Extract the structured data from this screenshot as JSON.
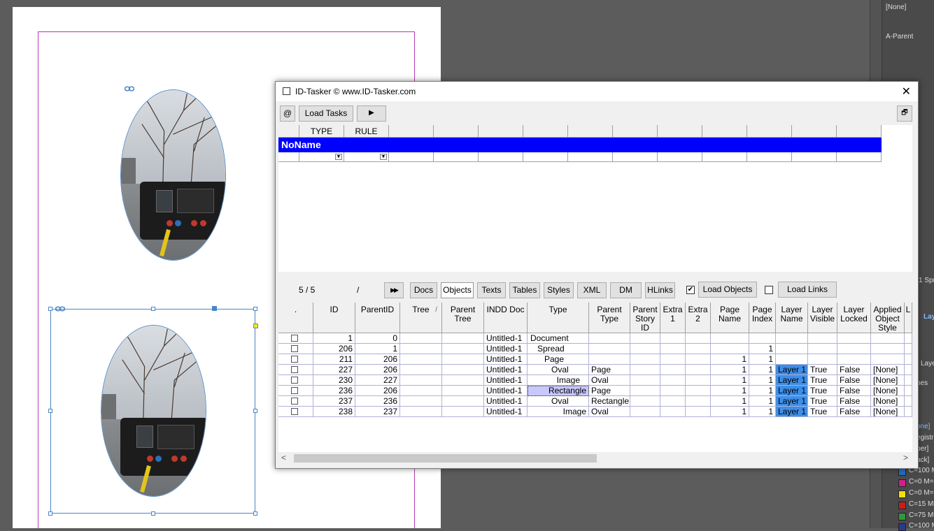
{
  "right_panel": {
    "none_label": "[None]",
    "a_parent_label": "A-Parent",
    "fragments": [
      "1 Spr",
      "Lay",
      "Laye",
      "hes",
      "one]",
      "egistra",
      "per]",
      "ack]",
      "C=100 M=",
      "C=0 M=",
      "C=0 M=",
      "C=15 M=",
      "C=75 M=",
      "C=100 M="
    ],
    "swatch_colors": [
      "#1f6fc2",
      "#d0208a",
      "#f2e000",
      "#c42020",
      "#2e9a3a",
      "#2a3a8c"
    ]
  },
  "dialog": {
    "title": "ID-Tasker  © www.ID-Tasker.com",
    "close_symbol": "✕",
    "at_label": "@",
    "load_tasks_label": "Load Tasks",
    "play_symbol": "▶",
    "restore_symbol": "🗗",
    "task_grid": {
      "headers": [
        "",
        "TYPE",
        "RULE",
        "",
        "",
        "",
        "",
        "",
        "",
        "",
        "",
        "",
        ""
      ],
      "noname": "NoName"
    },
    "toolbar2": {
      "counter": "5 / 5",
      "slash": "/",
      "ff_symbol": "▶▶",
      "tabs": [
        "Docs",
        "Objects",
        "Texts",
        "Tables",
        "Styles",
        "XML",
        "DM",
        "HLinks"
      ],
      "active_tab": "Objects",
      "load_objects_checked": true,
      "load_objects_label": "Load Objects",
      "load_links_checked": false,
      "load_links_label": "Load Links"
    },
    "objects_grid": {
      "headers": [
        ".",
        "ID",
        "ParentID",
        "Tree",
        "Parent Tree",
        "INDD Doc",
        "Type",
        "Parent Type",
        "Parent Story ID",
        "Extra 1",
        "Extra 2",
        "Page Name",
        "Page Index",
        "Layer Name",
        "Layer Visible",
        "Layer Locked",
        "Applied Object Style",
        "L"
      ],
      "sort_indicator": "/",
      "rows": [
        {
          "id": "1",
          "parent": "0",
          "doc": "Untitled-1",
          "type": "Document",
          "ptype": "",
          "pname": "",
          "pindex": "",
          "layer": "",
          "visible": "",
          "locked": "",
          "style": ""
        },
        {
          "id": "206",
          "parent": "1",
          "doc": "Untitled-1",
          "type": "Spread",
          "ptype": "",
          "pname": "",
          "pindex": "1",
          "layer": "",
          "visible": "",
          "locked": "",
          "style": ""
        },
        {
          "id": "211",
          "parent": "206",
          "doc": "Untitled-1",
          "type": "Page",
          "ptype": "",
          "pname": "1",
          "pindex": "1",
          "layer": "",
          "visible": "",
          "locked": "",
          "style": ""
        },
        {
          "id": "227",
          "parent": "206",
          "doc": "Untitled-1",
          "type": "Oval",
          "ptype": "Page",
          "pname": "1",
          "pindex": "1",
          "layer": "Layer 1",
          "visible": "True",
          "locked": "False",
          "style": "[None]"
        },
        {
          "id": "230",
          "parent": "227",
          "doc": "Untitled-1",
          "type": "Image",
          "ptype": "Oval",
          "pname": "1",
          "pindex": "1",
          "layer": "Layer 1",
          "visible": "True",
          "locked": "False",
          "style": "[None]"
        },
        {
          "id": "236",
          "parent": "206",
          "doc": "Untitled-1",
          "type": "Rectangle",
          "ptype": "Page",
          "pname": "1",
          "pindex": "1",
          "layer": "Layer 1",
          "visible": "True",
          "locked": "False",
          "style": "[None]"
        },
        {
          "id": "237",
          "parent": "236",
          "doc": "Untitled-1",
          "type": "Oval",
          "ptype": "Rectangle",
          "pname": "1",
          "pindex": "1",
          "layer": "Layer 1",
          "visible": "True",
          "locked": "False",
          "style": "[None]"
        },
        {
          "id": "238",
          "parent": "237",
          "doc": "Untitled-1",
          "type": "Image",
          "ptype": "Oval",
          "pname": "1",
          "pindex": "1",
          "layer": "Layer 1",
          "visible": "True",
          "locked": "False",
          "style": "[None]"
        }
      ]
    },
    "scroll_left": "<",
    "scroll_right": ">"
  },
  "colors": {
    "selection_blue": "#0000ff",
    "layer_highlight": "#3d8ee8",
    "frame_border": "#4a86c5",
    "margin_guide": "#b33bb3"
  }
}
